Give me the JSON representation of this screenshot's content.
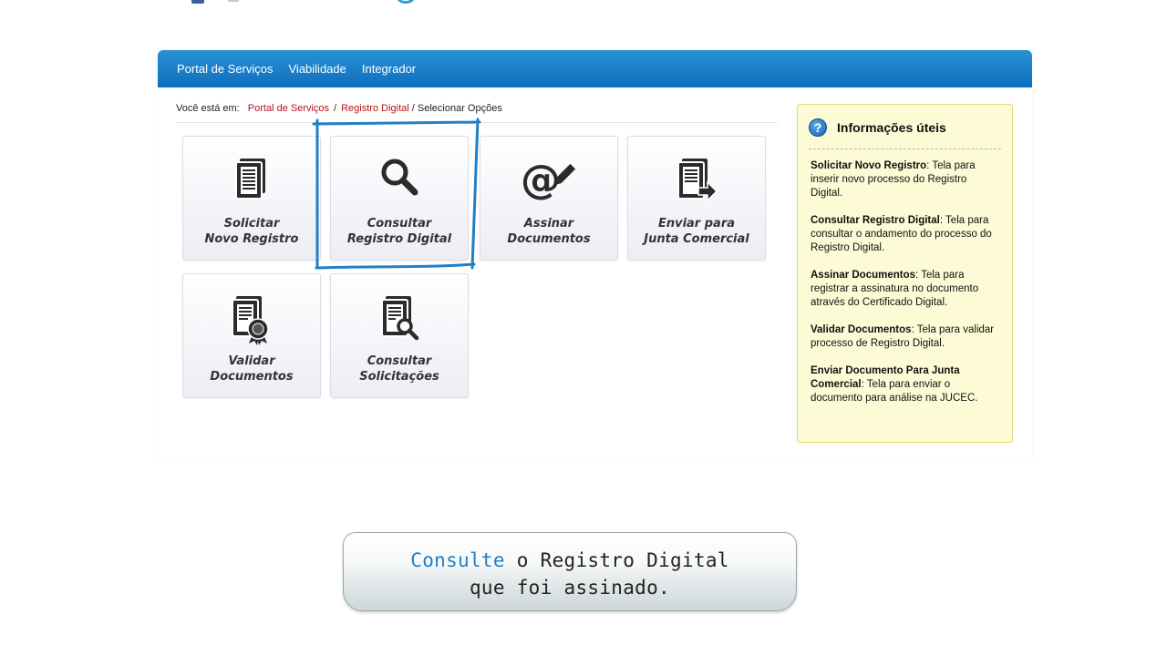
{
  "nav": {
    "items": [
      "Portal de Serviços",
      "Viabilidade",
      "Integrador"
    ]
  },
  "breadcrumb": {
    "label": "Você está em:",
    "links": [
      "Portal de Serviços",
      "Registro Digital"
    ],
    "current": "/ Selecionar Opções"
  },
  "tiles": [
    {
      "line1": "Solicitar",
      "line2": "Novo Registro",
      "icon": "document-list-icon"
    },
    {
      "line1": "Consultar",
      "line2": "Registro Digital",
      "icon": "magnifier-icon"
    },
    {
      "line1": "Assinar",
      "line2": "Documentos",
      "icon": "at-pen-icon"
    },
    {
      "line1": "Enviar para",
      "line2": "Junta Comercial",
      "icon": "document-send-icon"
    },
    {
      "line1": "Validar",
      "line2": "Documentos",
      "icon": "document-seal-icon"
    },
    {
      "line1": "Consultar",
      "line2": "Solicitações",
      "icon": "document-search-icon"
    }
  ],
  "info": {
    "title": "Informações úteis",
    "icon": "question-icon",
    "items": [
      {
        "term": "Solicitar Novo Registro",
        "desc": ": Tela para inserir novo processo do Registro Digital."
      },
      {
        "term": "Consultar Registro Digital",
        "desc": ": Tela para consultar o andamento do processo do Registro Digital."
      },
      {
        "term": "Assinar Documentos",
        "desc": ": Tela para registrar a assinatura no documento através do Certificado Digital."
      },
      {
        "term": "Validar Documentos",
        "desc": ": Tela para validar processo de Registro Digital."
      },
      {
        "term": "Enviar Documento Para Junta Comercial",
        "desc": ": Tela para enviar o documento para análise na JUCEC."
      }
    ]
  },
  "caption": {
    "highlight": "Consulte",
    "rest": " o Registro Digital",
    "line2": "que foi assinado."
  },
  "colors": {
    "nav_blue": "#0d6fbd",
    "link_red": "#b2121b",
    "highlight_blue": "#1f7fc6",
    "info_bg": "#fdfbd5"
  }
}
